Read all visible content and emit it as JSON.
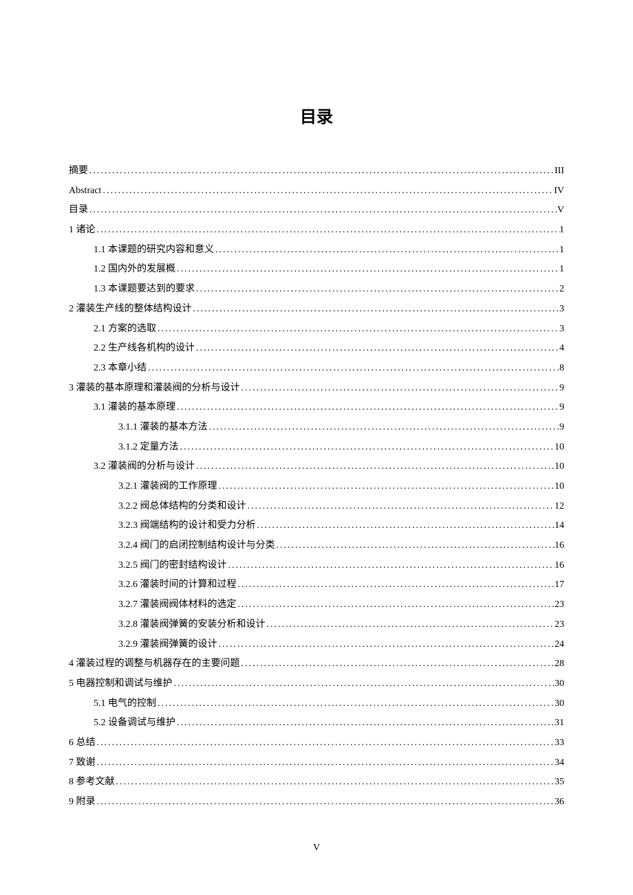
{
  "title": "目录",
  "page_number": "V",
  "toc": [
    {
      "level": 0,
      "label": "摘要",
      "page": "III"
    },
    {
      "level": 0,
      "label": "Abstract",
      "page": "IV"
    },
    {
      "level": 0,
      "label": "目录",
      "page": "V"
    },
    {
      "level": 0,
      "label": "1  诸论",
      "page": "1"
    },
    {
      "level": 1,
      "label": "1.1  本课题的研究内容和意义",
      "page": "1"
    },
    {
      "level": 1,
      "label": "1.2 国内外的发展概",
      "page": "1"
    },
    {
      "level": 1,
      "label": "1.3  本课题要达到的要求",
      "page": "2"
    },
    {
      "level": 0,
      "label": "2  灌装生产线的整体结构设计",
      "page": "3"
    },
    {
      "level": 1,
      "label": "2.1  方案的选取",
      "page": "3"
    },
    {
      "level": 1,
      "label": "2.2  生产线各机构的设计",
      "page": "4"
    },
    {
      "level": 1,
      "label": "2.3  本章小结",
      "page": "8"
    },
    {
      "level": 0,
      "label": "3  灌装的基本原理和灌装阀的分析与设计",
      "page": "9"
    },
    {
      "level": 1,
      "label": "3.1  灌装的基本原理",
      "page": "9"
    },
    {
      "level": 2,
      "label": "3.1.1  灌装的基本方法",
      "page": "9"
    },
    {
      "level": 2,
      "label": "3.1.2  定量方法",
      "page": "10"
    },
    {
      "level": 1,
      "label": "3.2  灌装阀的分析与设计",
      "page": "10"
    },
    {
      "level": 2,
      "label": "3.2.1 灌装阀的工作原理",
      "page": "10"
    },
    {
      "level": 2,
      "label": "3.2.2 阀总体结构的分类和设计",
      "page": "12"
    },
    {
      "level": 2,
      "label": "3.2.3 阀端结构的设计和受力分析",
      "page": "14"
    },
    {
      "level": 2,
      "label": "3.2.4 阀门的启闭控制结构设计与分类",
      "page": "16"
    },
    {
      "level": 2,
      "label": "3.2.5 阀门的密封结构设计",
      "page": "16"
    },
    {
      "level": 2,
      "label": "3.2.6  灌装时间的计算和过程",
      "page": "17"
    },
    {
      "level": 2,
      "label": "3.2.7 灌装阀阀体材料的选定",
      "page": "23"
    },
    {
      "level": 2,
      "label": "3.2.8 灌装阀弹簧的安装分析和设计",
      "page": "23"
    },
    {
      "level": 2,
      "label": "3.2.9  灌装阀弹簧的设计",
      "page": "24"
    },
    {
      "level": 0,
      "label": "4 灌装过程的调整与机器存在的主要问题",
      "page": "28"
    },
    {
      "level": 0,
      "label": "5  电器控制和调试与维护",
      "page": "30"
    },
    {
      "level": 1,
      "label": "5.1 电气的控制",
      "page": "30"
    },
    {
      "level": 1,
      "label": "5.2 设备调试与维护",
      "page": "31"
    },
    {
      "level": 0,
      "label": "6 总结",
      "page": "33"
    },
    {
      "level": 0,
      "label": "7  致谢",
      "page": "34"
    },
    {
      "level": 0,
      "label": "8  参考文献",
      "page": "35"
    },
    {
      "level": 0,
      "label": "9  附录",
      "page": "36"
    }
  ]
}
